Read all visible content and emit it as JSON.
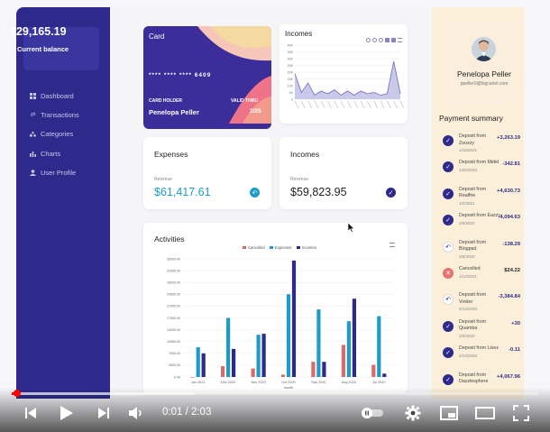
{
  "sidebar": {
    "balance": "$29,165.19",
    "balance_label": "Current balance",
    "items": [
      {
        "label": "Dashboard",
        "icon": "dashboard-icon"
      },
      {
        "label": "Transactions",
        "icon": "transactions-icon"
      },
      {
        "label": "Categories",
        "icon": "categories-icon"
      },
      {
        "label": "Charts",
        "icon": "charts-icon"
      },
      {
        "label": "User Profile",
        "icon": "user-icon"
      }
    ]
  },
  "card": {
    "title": "Card",
    "number": "**** **** **** 6409",
    "holder_label": "CARD HOLDER",
    "holder_name": "Penelopa Peller",
    "valid_label": "VALID THRU",
    "valid_date": "2/25"
  },
  "incomes_chart": {
    "title": "Incomes",
    "chart_data": {
      "type": "area",
      "yticks": [
        "40K",
        "35K",
        "30K",
        "25K",
        "20K",
        "15K",
        "10K",
        "5K",
        "0"
      ],
      "values": [
        19,
        5,
        12,
        3,
        6,
        4,
        7,
        3,
        6,
        3,
        6,
        4,
        5,
        3,
        4,
        28,
        4
      ],
      "ylim": [
        0,
        40
      ]
    }
  },
  "expenses": {
    "title": "Expenses",
    "sub": "Revenue",
    "value": "$61,417.61"
  },
  "incomes": {
    "title": "Incomes",
    "sub": "Revenue",
    "value": "$59,823.95"
  },
  "activities": {
    "title": "Activities",
    "chart_data": {
      "type": "bar",
      "legend": [
        "Cancelled",
        "Expenses",
        "Incomes"
      ],
      "colors": [
        "#d96b6b",
        "#1e9bc8",
        "#2e2a8c"
      ],
      "categories": [
        "Jan 2021",
        "Dec 2020",
        "Nov 2020",
        "Oct 2020",
        "Sep 2020",
        "Aug 2020",
        "Jul 2020"
      ],
      "yticks": [
        "35000.00",
        "31500.00",
        "28000.00",
        "24500.00",
        "21000.00",
        "17500.00",
        "14000.00",
        "10500.00",
        "7000.00",
        "3500.00",
        "0.00"
      ],
      "xlabel": "month",
      "ylim": [
        0,
        35000
      ],
      "series": [
        {
          "name": "Cancelled",
          "values": [
            0,
            3200,
            2500,
            700,
            4500,
            9500,
            3600
          ]
        },
        {
          "name": "Expenses",
          "values": [
            8800,
            17500,
            12500,
            24500,
            20000,
            16500,
            18000
          ]
        },
        {
          "name": "Incomes",
          "values": [
            7000,
            8300,
            12800,
            34500,
            4500,
            23200,
            1000
          ]
        }
      ]
    }
  },
  "profile": {
    "name": "Penelopa Peller",
    "email": "ppeller0@bigcartel.com"
  },
  "payments": {
    "title": "Payment summary",
    "items": [
      {
        "title": "Deposit from Zoozzy",
        "date": "1/16/2021",
        "amount": "+3,263.19",
        "type": "check"
      },
      {
        "title": "Deposit from Midel",
        "date": "12/6/2020",
        "amount": "-342.81",
        "type": "check"
      },
      {
        "title": "Deposit from Realfire",
        "date": "1/2/2021",
        "amount": "+4,630.73",
        "type": "check"
      },
      {
        "title": "Deposit from Eazzy",
        "date": "3/6/2020",
        "amount": "-4,094.63",
        "type": "check"
      },
      {
        "title": "Deposit from Blogpad",
        "date": "3/5/2020",
        "amount": "-138.29",
        "type": "undo"
      },
      {
        "title": "Cancelled",
        "date": "1/12/2021",
        "amount": "$24.22",
        "type": "cancel"
      },
      {
        "title": "Deposit from Vinder",
        "date": "9/13/2020",
        "amount": "-3,384.84",
        "type": "undo"
      },
      {
        "title": "Deposit from Quamba",
        "date": "3/3/2020",
        "amount": "+30",
        "type": "check"
      },
      {
        "title": "Deposit from Livez",
        "date": "4/13/2020",
        "amount": "-0.11",
        "type": "check"
      },
      {
        "title": "Deposit from Dazzlesphere",
        "date": "",
        "amount": "+4,067.96",
        "type": "check"
      }
    ]
  },
  "video": {
    "time": "0:01 / 2:03",
    "progress": 0.01
  }
}
